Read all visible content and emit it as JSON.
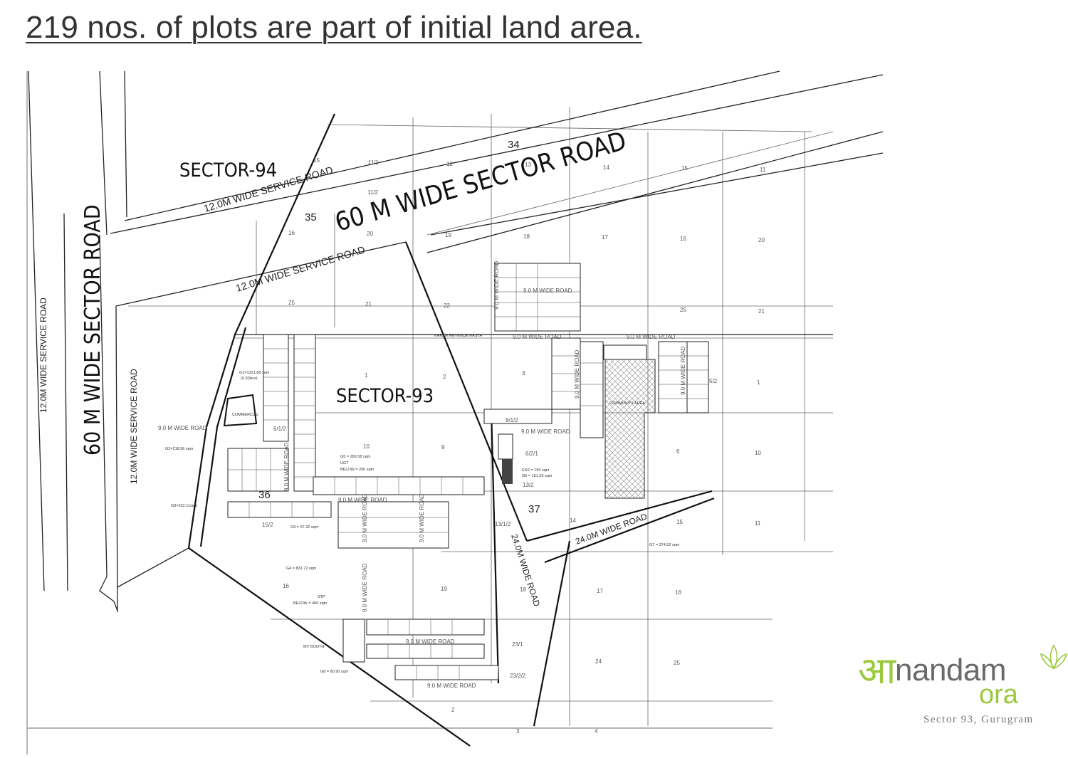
{
  "heading": "219 nos. of plots are part of initial land area.",
  "roads": {
    "sector_road_main": "60 M WIDE SECTOR ROAD",
    "sector_road_left": "60 M WIDE SECTOR ROAD",
    "service_top": "12.0M WIDE SERVICE ROAD",
    "service_mid": "12.0M WIDE SERVICE ROAD",
    "service_left_outer": "12.0M WIDE SERVICE ROAD",
    "service_left_inner": "12.0M WIDE SERVICE ROAD",
    "road_24_diag": "24.0M WIDE ROAD",
    "road_24_lower": "24.0M WIDE ROAD",
    "nine_m": "9.0 M WIDE ROAD",
    "karam_rasta": "KARAM REVENUE RASTA"
  },
  "sectors": {
    "s94": "SECTOR-94",
    "s93": "SECTOR-93"
  },
  "rect_numbers": {
    "r34": "34",
    "r35": "35",
    "r36": "36",
    "r37": "37"
  },
  "areas": {
    "g1": "G1=1221.88 sqm",
    "g1b": "(0.30Acs)",
    "commercial": "COMMERCIAL",
    "g2": "G2=218.96 sqm",
    "g3": "G3=322.11sqm",
    "g4": "G4 = 831.72 sqm",
    "g5": "G5 = 266.58 sqm",
    "ugt": "UGT",
    "ugt_below": "BELOW = 200 sqm",
    "ess": "ESS = 150 sqm",
    "g6": "G6 = 151.29 sqm",
    "g7": "G7 = 374.52 sqm",
    "g8": "G8 = 80.95 sqm",
    "g9": "G9 = 57.32 sqm",
    "stp": "STP",
    "stp_below": "BELOW = 450 sqm",
    "mv_booth": "MV BOOTH",
    "community": "COMMUNITY AREA"
  },
  "killa": {
    "top_row": [
      "15",
      "11/1",
      "12",
      "13",
      "14",
      "15",
      "11"
    ],
    "row2": [
      "16",
      "20",
      "19",
      "18",
      "17",
      "16",
      "20"
    ],
    "row3": [
      "25",
      "21",
      "22",
      "25",
      "21"
    ],
    "row4": [
      "1",
      "2",
      "3",
      "5/2",
      "1"
    ],
    "row5": [
      "10",
      "9",
      "6",
      "10"
    ],
    "row6": [
      "13/2",
      "13/1/2",
      "14",
      "15",
      "11"
    ],
    "row7": [
      "16",
      "19",
      "18",
      "17",
      "16"
    ],
    "row8": [
      "23/1",
      "24",
      "25",
      "23/2/2",
      "2",
      "3",
      "4"
    ],
    "misc": [
      "11/2",
      "6/1/2",
      "6/2/1",
      "15/2",
      "8/1/2"
    ]
  },
  "logo": {
    "mark": "आ",
    "name": "nandam",
    "sub": "ora",
    "location": "Sector 93, Gurugram"
  },
  "colors": {
    "line": "#222222",
    "grid": "#555555",
    "logo_green": "#9bc83e",
    "logo_grey": "#6a6a6a"
  }
}
